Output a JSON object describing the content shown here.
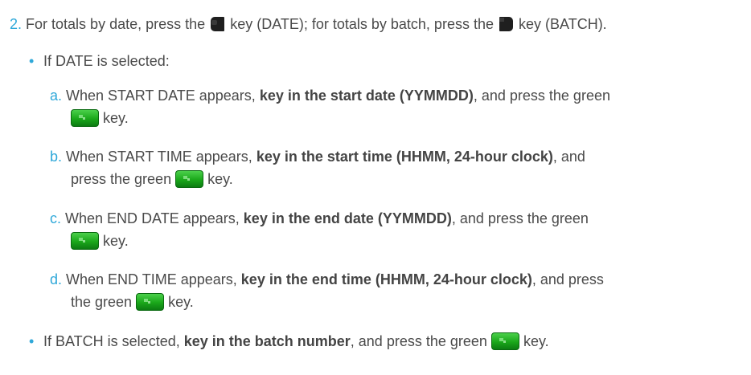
{
  "step2": {
    "number": "2.",
    "text_part1": "For totals by date, press the",
    "text_part2": "key (DATE); for totals by batch, press the",
    "text_part3": "key (BATCH)."
  },
  "date_section": {
    "bullet": "•",
    "label": "If DATE is selected:"
  },
  "substeps": {
    "a": {
      "letter": "a.",
      "prefix": "When START DATE appears,",
      "bold": "key in the start date (YYMMDD)",
      "suffix": ", and press the green",
      "end": "key."
    },
    "b": {
      "letter": "b.",
      "prefix": "When START TIME appears,",
      "bold": "key in the start time (HHMM, 24-hour clock)",
      "suffix": ", and",
      "line2_prefix": "press the green",
      "end": "key."
    },
    "c": {
      "letter": "c.",
      "prefix": "When END DATE appears,",
      "bold": "key in the end date (YYMMDD)",
      "suffix": ", and press the green",
      "end": "key."
    },
    "d": {
      "letter": "d.",
      "prefix": "When END TIME appears,",
      "bold": "key in the end time (HHMM, 24-hour clock)",
      "suffix": ", and press",
      "line2_prefix": "the green",
      "end": "key."
    }
  },
  "batch_section": {
    "bullet": "•",
    "prefix": "If BATCH is selected,",
    "bold": "key in the batch number",
    "suffix": ", and press the green",
    "end": "key."
  },
  "icons": {
    "date_key": "left-softkey-icon",
    "batch_key": "right-softkey-icon",
    "enter_key": "green-enter-key-icon",
    "green_color": "#1aa71a",
    "accent_color": "#2fa8d9"
  }
}
